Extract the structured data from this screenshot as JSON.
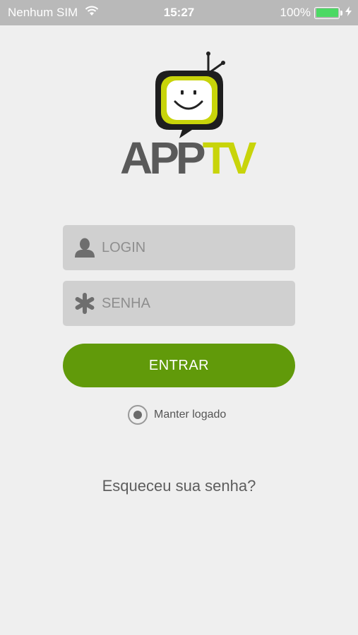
{
  "status_bar": {
    "carrier": "Nenhum SIM",
    "time": "15:27",
    "battery": "100%",
    "battery_level": 1.0,
    "battery_color": "#4cd964"
  },
  "logo": {
    "text_app": "APP",
    "text_tv": "TV",
    "icon": "tv-mascot-icon",
    "colors": {
      "app": "#5a5a5a",
      "tv": "#c8d40a"
    }
  },
  "form": {
    "login_placeholder": "LOGIN",
    "login_icon": "user-icon",
    "senha_placeholder": "SENHA",
    "senha_icon": "asterisk-icon",
    "submit_label": "ENTRAR",
    "submit_color": "#619a0a",
    "keep_logged_label": "Manter logado",
    "keep_logged_checked": true
  },
  "forgot_password": "Esqueceu sua senha?"
}
